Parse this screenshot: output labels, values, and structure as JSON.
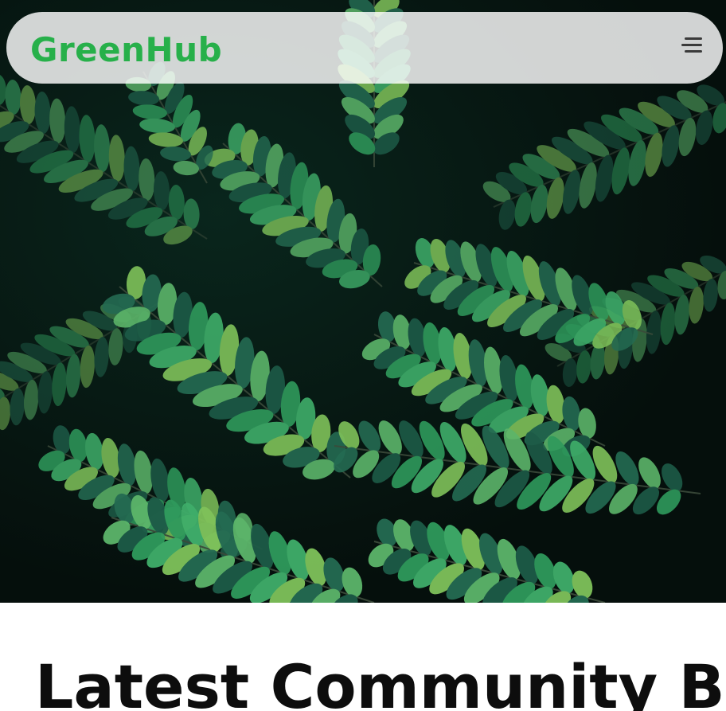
{
  "navbar": {
    "brand": "GreenHub",
    "menu_icon": "hamburger-menu-icon"
  },
  "hero": {
    "image": "fern-leaves-photo"
  },
  "section": {
    "title": "Latest Community Buzz"
  },
  "colors": {
    "brand": "#27b04a",
    "hero_dark": "#04100c",
    "leaf_light": "#7fc25a",
    "leaf_mid": "#2f9a5c",
    "leaf_dark": "#1d5b47",
    "title": "#0d0d0d"
  }
}
